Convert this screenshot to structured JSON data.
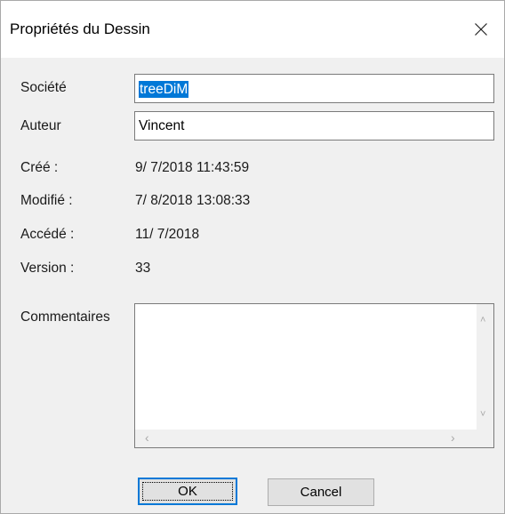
{
  "dialog": {
    "title": "Propriétés du Dessin",
    "close_glyph": "×"
  },
  "fields": {
    "societe_label": "Société",
    "societe_value": "treeDiM",
    "auteur_label": "Auteur",
    "auteur_value": "Vincent"
  },
  "info": {
    "cree_label": "Créé :",
    "cree_value": "9/ 7/2018  11:43:59",
    "modifie_label": "Modifié :",
    "modifie_value": "7/ 8/2018  13:08:33",
    "accede_label": "Accédé :",
    "accede_value": "11/ 7/2018",
    "version_label": "Version :",
    "version_value": "33"
  },
  "comments": {
    "label": "Commentaires",
    "value": ""
  },
  "buttons": {
    "ok_label": "OK",
    "cancel_label": "Cancel"
  },
  "colors": {
    "accent": "#0078d7",
    "dialog_bg": "#f0f0f0",
    "button_bg": "#e1e1e1"
  },
  "icons": {
    "close": "close-icon",
    "scroll_up": "chevron-up-icon",
    "scroll_down": "chevron-down-icon",
    "scroll_left": "chevron-left-icon",
    "scroll_right": "chevron-right-icon"
  }
}
